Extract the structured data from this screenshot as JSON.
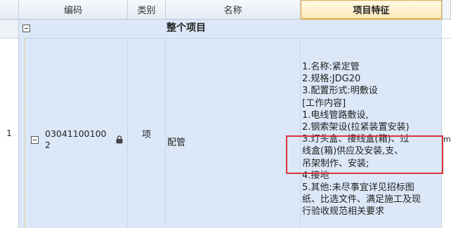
{
  "columns": {
    "code": "编码",
    "type": "类别",
    "name": "名称",
    "features": "项目特征"
  },
  "project_row": {
    "label": "整个项目"
  },
  "item_row": {
    "row_number": "1",
    "code_line1": "03041100100",
    "code_line2": "2",
    "type": "项",
    "name": "配管",
    "lock_icon": "lock-icon",
    "overflow_char": "m",
    "features": [
      "1.名称:紧定管",
      "2.规格:JDG20",
      "3.配置形式:明敷设",
      "[工作内容]",
      "1.电线管路敷设,",
      "2.钢索架设(拉紧装置安装)",
      "3.灯头盒、接线盒(箱)、过",
      "线盒(箱)供应及安装,支、",
      "吊架制作、安装;",
      "4.接地",
      "5.其他:未尽事宜详见招标图",
      "纸、比选文件、满足施工及现",
      "行验收规范相关要求"
    ]
  },
  "colors": {
    "header_active": "#fde9b8",
    "row_highlight": "#dce8f7",
    "annotation_box": "#d9343b"
  }
}
